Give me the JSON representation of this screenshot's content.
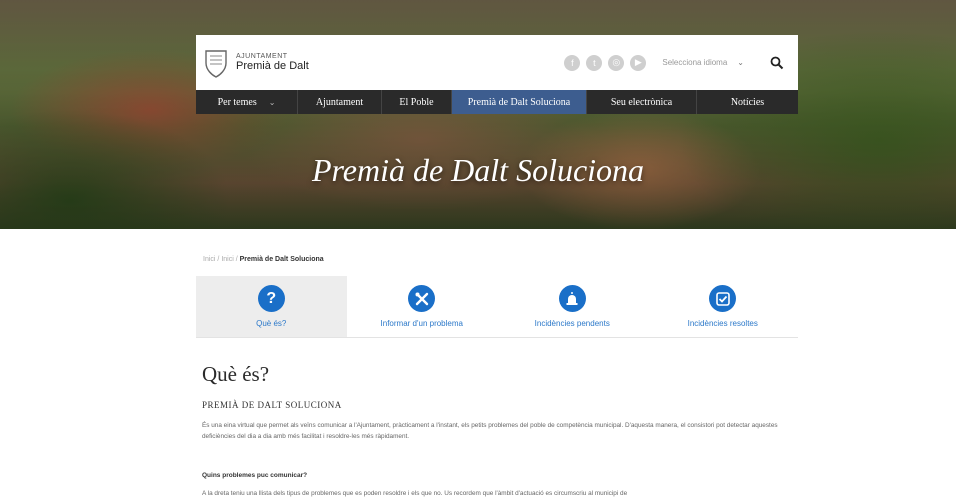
{
  "hero": {
    "title": "Premià de Dalt Soluciona"
  },
  "header": {
    "logo_small": "AJUNTAMENT",
    "logo_name": "Premià de Dalt",
    "social_icons": [
      "facebook-icon",
      "twitter-icon",
      "instagram-icon",
      "youtube-icon"
    ],
    "language_selector": "Selecciona idioma",
    "search_icon": "search-icon"
  },
  "nav": {
    "items": [
      {
        "label": "Per temes",
        "has_dropdown": true
      },
      {
        "label": "Ajuntament"
      },
      {
        "label": "El Poble"
      },
      {
        "label": "Premià de Dalt Soluciona",
        "active": true
      },
      {
        "label": "Seu electrònica"
      },
      {
        "label": "Notícies"
      }
    ]
  },
  "breadcrumb": {
    "home": "Inici",
    "sep1": "/",
    "level1": "Inici",
    "sep2": "/",
    "current": "Premià de Dalt Soluciona"
  },
  "tabs": [
    {
      "label": "Què és?",
      "icon": "question-icon",
      "active": true
    },
    {
      "label": "Informar d'un problema",
      "icon": "tools-icon"
    },
    {
      "label": "Incidències pendents",
      "icon": "alarm-icon"
    },
    {
      "label": "Incidències resoltes",
      "icon": "checkbox-icon"
    }
  ],
  "content": {
    "heading": "Què és?",
    "subheading": "PREMIÀ DE DALT SOLUCIONA",
    "paragraph": "És una eina virtual que permet als veïns comunicar a l'Ajuntament, pràcticament a l'instant, els petits problemes del poble de competència municipal. D'aquesta manera, el consistori pot detectar aquestes deficiències del dia a dia amb més facilitat i resoldre-les més ràpidament.",
    "question": "Quins problemes puc comunicar?",
    "paragraph2": "A la dreta teniu una llista dels tipus de problemes que es poden resoldre i els que no. Us recordem que l'àmbit d'actuació es circumscriu al municipi de"
  },
  "colors": {
    "accent": "#1a6fc8",
    "nav_bg": "#2a2a2a",
    "nav_active": "#3d5d8f"
  }
}
